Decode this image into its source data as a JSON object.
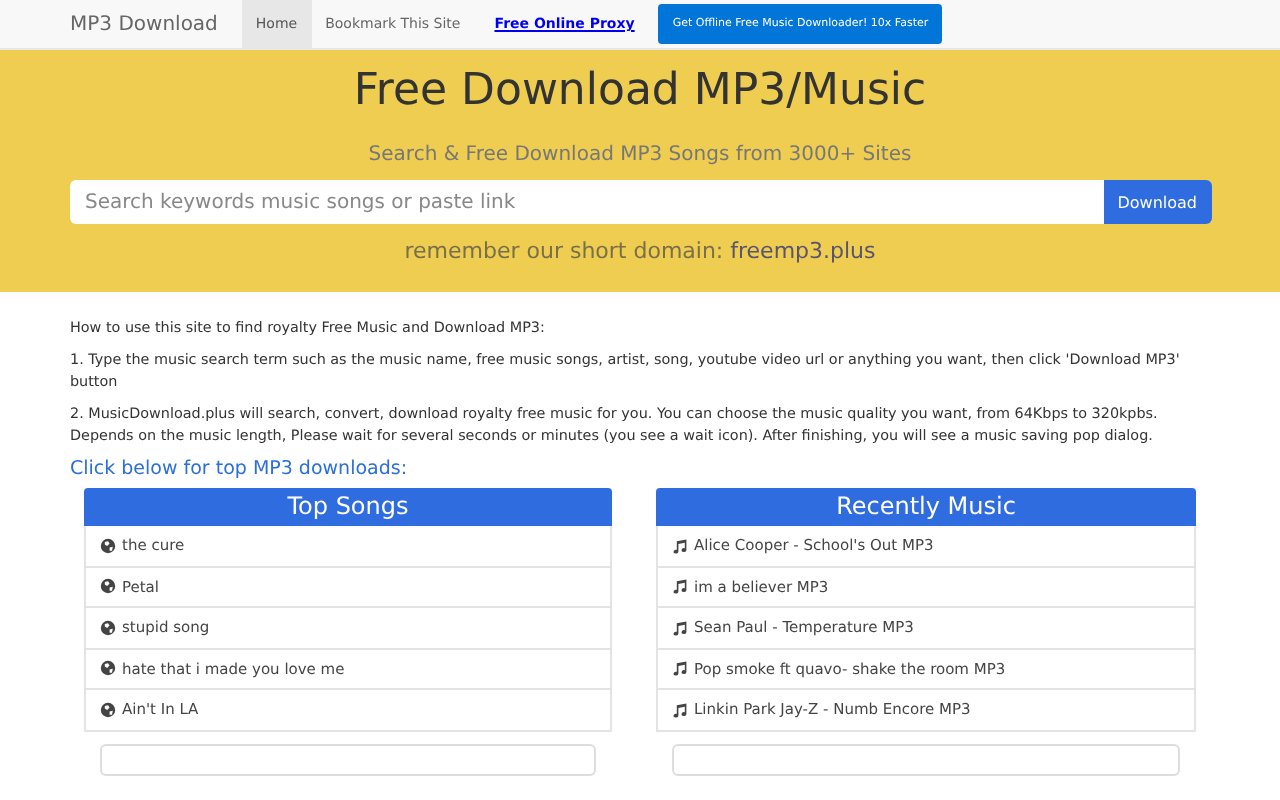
{
  "navbar": {
    "brand": "MP3 Download",
    "items": [
      {
        "label": "Home",
        "kind": "tab",
        "selected": true
      },
      {
        "label": "Bookmark This Site",
        "kind": "tab",
        "selected": false
      },
      {
        "label": "Free Online Proxy",
        "kind": "link",
        "selected": false
      },
      {
        "label": "Get Offline Free Music Downloader! 10x Faster",
        "kind": "button",
        "selected": false
      }
    ]
  },
  "hero": {
    "title": "Free Download MP3/Music",
    "subtitle": "Search & Free Download MP3 Songs from 3000+ Sites",
    "search": {
      "placeholder": "Search keywords music songs or paste link",
      "button": "Download"
    },
    "domain_note": "remember our short domain:",
    "domain": "freemp3.plus"
  },
  "instructions": {
    "intro": "How to use this site to find royalty Free Music and Download MP3:",
    "steps": [
      "1. Type the music search term such as the music name, free music songs, artist, song, youtube video url or anything you want, then click 'Download MP3' button",
      "2. MusicDownload.plus will search, convert, download royalty free music for you. You can choose the music quality you want, from 64Kbps to 320kpbs. Depends on the music length, Please wait for several seconds or minutes (you see a wait icon). After finishing, you will see a music saving pop dialog."
    ]
  },
  "lists_heading": "Click below for top MP3 downloads:",
  "lists": [
    {
      "title": "Top Songs",
      "kind": "globe",
      "items": [
        "the cure",
        "Petal",
        "stupid song",
        "hate that i made you love me",
        "Ain't In LA"
      ]
    },
    {
      "title": "Recently Music",
      "kind": "note",
      "items": [
        "Alice Cooper - School's Out MP3",
        "im a believer MP3",
        "Sean Paul - Temperature MP3",
        "Pop smoke ft quavo- shake the room MP3",
        "Linkin Park Jay-Z - Numb Encore MP3"
      ]
    }
  ]
}
